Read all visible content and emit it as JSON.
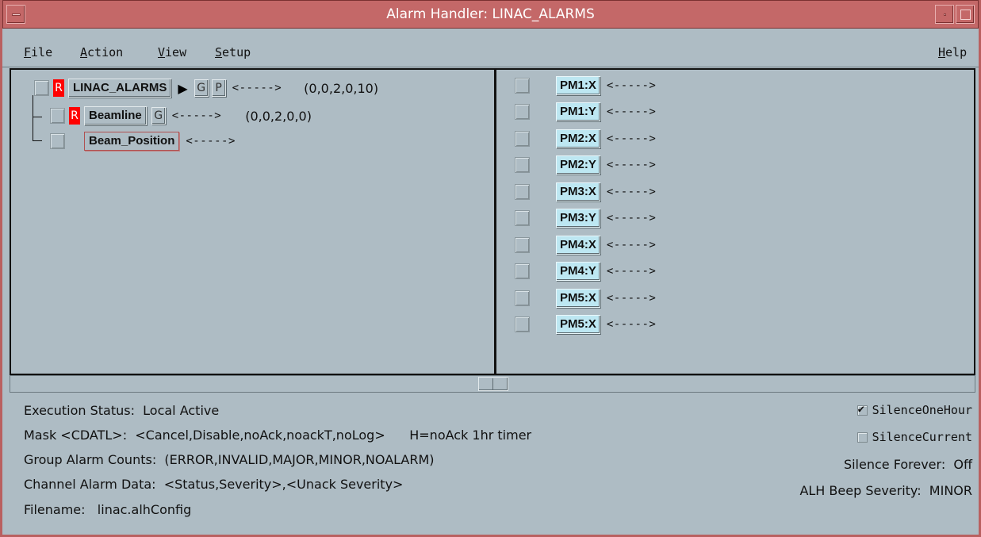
{
  "window": {
    "title": "Alarm Handler: LINAC_ALARMS"
  },
  "menubar": {
    "file": {
      "mnemonic": "F",
      "rest": "ile"
    },
    "action": {
      "mnemonic": "A",
      "rest": "ction"
    },
    "view": {
      "mnemonic": "V",
      "rest": "iew"
    },
    "setup": {
      "mnemonic": "S",
      "rest": "etup"
    },
    "help": {
      "mnemonic": "H",
      "rest": "elp"
    }
  },
  "tree": {
    "root": {
      "r_label": "R",
      "name": "LINAC_ALARMS",
      "expand_glyph": "▶",
      "g_label": "G",
      "p_label": "P",
      "status": "<----->",
      "counts": "(0,0,2,0,10)"
    },
    "group": {
      "r_label": "R",
      "name": "Beamline",
      "g_label": "G",
      "status": "<----->",
      "counts": "(0,0,2,0,0)"
    },
    "leaf": {
      "name": "Beam_Position",
      "status": "<----->"
    }
  },
  "channels": [
    {
      "name": "PM1:X",
      "status": "<----->"
    },
    {
      "name": "PM1:Y",
      "status": "<----->"
    },
    {
      "name": "PM2:X",
      "status": "<----->"
    },
    {
      "name": "PM2:Y",
      "status": "<----->"
    },
    {
      "name": "PM3:X",
      "status": "<----->"
    },
    {
      "name": "PM3:Y",
      "status": "<----->"
    },
    {
      "name": "PM4:X",
      "status": "<----->"
    },
    {
      "name": "PM4:Y",
      "status": "<----->"
    },
    {
      "name": "PM5:X",
      "status": "<----->"
    },
    {
      "name": "PM5:X",
      "status": "<----->"
    }
  ],
  "status": {
    "execution": "Execution Status:  Local Active",
    "mask": "Mask <CDATL>:  <Cancel,Disable,noAck,noackT,noLog>      H=noAck 1hr timer",
    "group_counts": "Group Alarm Counts:  (ERROR,INVALID,MAJOR,MINOR,NOALARM)",
    "channel_data": "Channel Alarm Data:  <Status,Severity>,<Unack Severity>",
    "filename": "Filename:   linac.alhConfig",
    "silence_one_hour": {
      "label": "SilenceOneHour",
      "checked": true
    },
    "silence_current": {
      "label": "SilenceCurrent",
      "checked": false
    },
    "silence_forever": "Silence Forever:  Off",
    "beep_severity": "ALH Beep Severity:  MINOR"
  }
}
